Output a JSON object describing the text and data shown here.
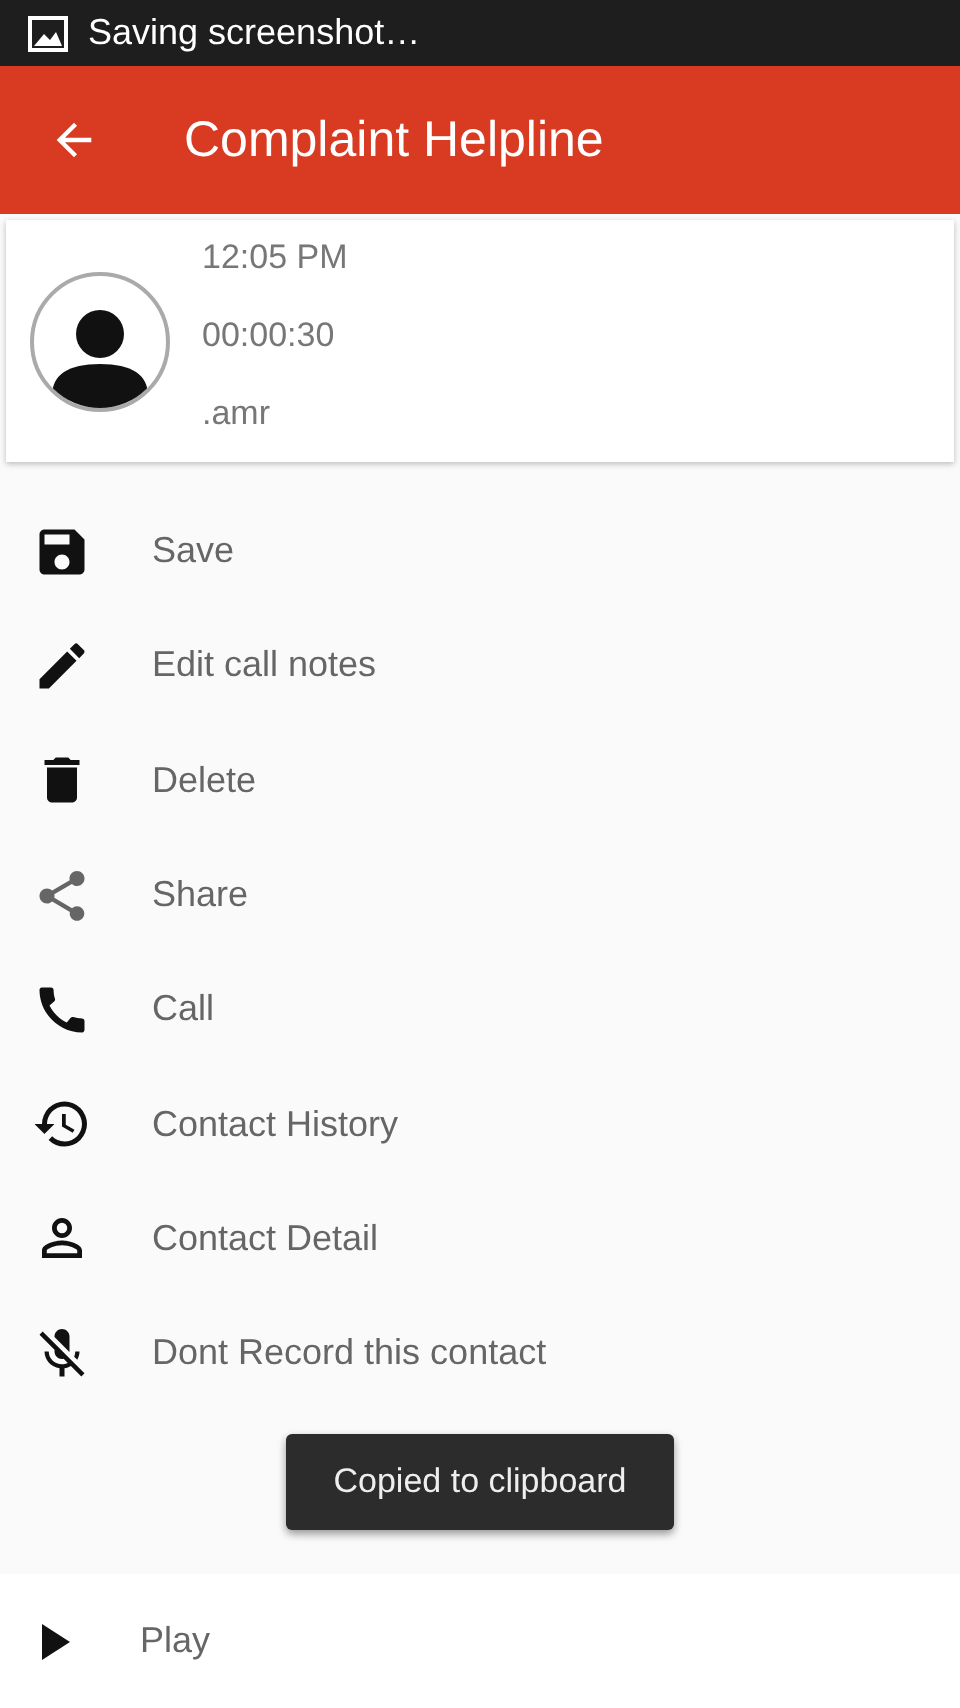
{
  "status_bar": {
    "notification": "Saving screenshot…"
  },
  "app_bar": {
    "title": "Complaint Helpline"
  },
  "call_card": {
    "time": "12:05 PM",
    "duration": "00:00:30",
    "file_type": ".amr"
  },
  "actions": [
    {
      "kind": "save",
      "label": "Save"
    },
    {
      "kind": "edit",
      "label": "Edit call notes"
    },
    {
      "kind": "delete",
      "label": "Delete"
    },
    {
      "kind": "share",
      "label": "Share"
    },
    {
      "kind": "call",
      "label": "Call"
    },
    {
      "kind": "history",
      "label": "Contact History"
    },
    {
      "kind": "contact",
      "label": "Contact Detail"
    },
    {
      "kind": "no-record",
      "label": "Dont Record this contact"
    }
  ],
  "toast": {
    "text": "Copied to clipboard"
  },
  "player": {
    "label": "Play"
  }
}
